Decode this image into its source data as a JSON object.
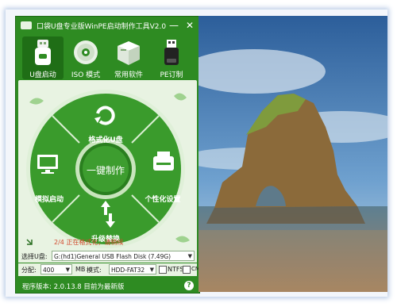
{
  "app": {
    "title": "口袋U盘专业版WinPE启动制作工具V2.0",
    "minimize_glyph": "—",
    "close_glyph": "✕"
  },
  "toolbar": {
    "items": [
      {
        "label": "U盘启动",
        "icon": "usb-drive-icon",
        "active": true
      },
      {
        "label": "ISO 模式",
        "icon": "disc-icon",
        "active": false
      },
      {
        "label": "常用软件",
        "icon": "software-box-icon",
        "active": false
      },
      {
        "label": "PE订制",
        "icon": "usb-stick-icon",
        "active": false
      }
    ]
  },
  "wheel": {
    "center_label": "一键制作",
    "segments": {
      "top": "格式化U盘",
      "left": "模拟启动",
      "right": "个性化设置",
      "bottom": "升级替换"
    }
  },
  "status": {
    "progress_text": "2/4 正在格式化，请稍候"
  },
  "device": {
    "label": "选择U盘:",
    "value": "G:(hd1)General USB Flash Disk (7.49G)"
  },
  "partition": {
    "label": "分配:",
    "size_value": "400",
    "size_unit": "MB",
    "mode_label": "模式:",
    "mode_value": "HDD-FAT32",
    "ntfs_label": "NTFS",
    "cms_label": "CMS"
  },
  "footer": {
    "version_text": "程序版本: 2.0.13.8 目前为最新版",
    "help_glyph": "?"
  },
  "colors": {
    "brand_green": "#2e8b22",
    "panel_light": "#e8f3e2",
    "status_red": "#d24b2f"
  }
}
